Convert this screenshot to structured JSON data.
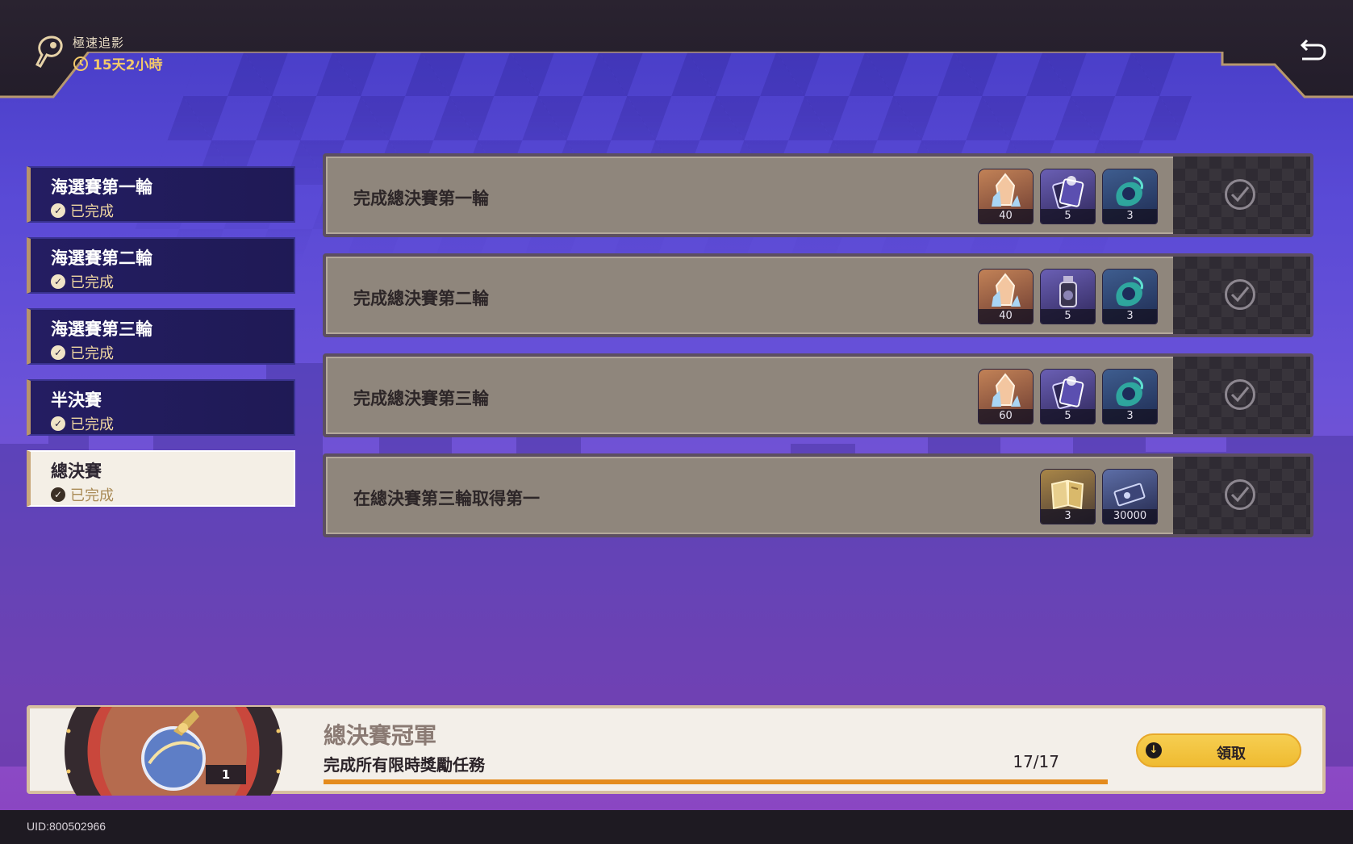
{
  "header": {
    "event_title": "極速追影",
    "timer": "15天2小時"
  },
  "tabs": [
    {
      "title": "海選賽第一輪",
      "status": "已完成",
      "active": false
    },
    {
      "title": "海選賽第二輪",
      "status": "已完成",
      "active": false
    },
    {
      "title": "海選賽第三輪",
      "status": "已完成",
      "active": false
    },
    {
      "title": "半決賽",
      "status": "已完成",
      "active": false
    },
    {
      "title": "總決賽",
      "status": "已完成",
      "active": true
    }
  ],
  "tasks": [
    {
      "label": "完成總決賽第一輪",
      "rewards": [
        {
          "icon": "crystal-icon",
          "count": "40",
          "tone": "orange"
        },
        {
          "icon": "card-pack-icon",
          "count": "5",
          "tone": "purple"
        },
        {
          "icon": "spirit-icon",
          "count": "3",
          "tone": "teal"
        }
      ],
      "claimed": true
    },
    {
      "label": "完成總決賽第二輪",
      "rewards": [
        {
          "icon": "crystal-icon",
          "count": "40",
          "tone": "orange"
        },
        {
          "icon": "potion-bottle-icon",
          "count": "5",
          "tone": "purple"
        },
        {
          "icon": "spirit-icon",
          "count": "3",
          "tone": "teal"
        }
      ],
      "claimed": true
    },
    {
      "label": "完成總決賽第三輪",
      "rewards": [
        {
          "icon": "crystal-icon",
          "count": "60",
          "tone": "orange"
        },
        {
          "icon": "card-pack-icon",
          "count": "5",
          "tone": "purple"
        },
        {
          "icon": "spirit-icon",
          "count": "3",
          "tone": "teal"
        }
      ],
      "claimed": true
    },
    {
      "label": "在總決賽第三輪取得第一",
      "rewards": [
        {
          "icon": "book-icon",
          "count": "3",
          "tone": "gold"
        },
        {
          "icon": "cash-bundle-icon",
          "count": "30000",
          "tone": "dark"
        }
      ],
      "claimed": true
    }
  ],
  "banner": {
    "title": "總決賽冠軍",
    "description": "完成所有限時獎勵任務",
    "progress_text": "17/17",
    "progress_fraction": 1.0,
    "medal_count": "1",
    "claim_label": "領取"
  },
  "footer": {
    "uid": "UID:800502966"
  },
  "colors": {
    "accent_gold": "#f2c96a",
    "progress": "#e48b1d",
    "claim_button": "#f6ce51"
  }
}
